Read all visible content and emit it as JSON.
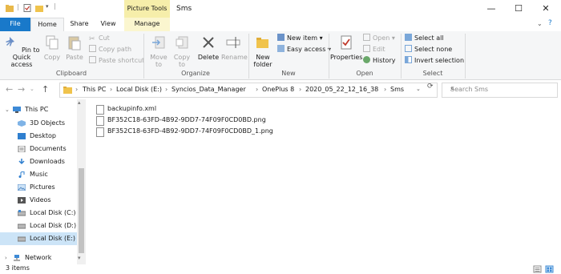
{
  "window": {
    "title": "Sms",
    "context_tab_group": "Picture Tools",
    "controls": {
      "minimize": "—",
      "maximize": "☐",
      "close": "✕"
    }
  },
  "tabs": [
    {
      "label": "File"
    },
    {
      "label": "Home"
    },
    {
      "label": "Share"
    },
    {
      "label": "View"
    },
    {
      "label": "Manage"
    }
  ],
  "ribbon": {
    "clipboard": {
      "label": "Clipboard",
      "pin_to_quick_access": "Pin to Quick access",
      "copy": "Copy",
      "paste": "Paste",
      "cut": "Cut",
      "copy_path": "Copy path",
      "paste_shortcut": "Paste shortcut"
    },
    "organize": {
      "label": "Organize",
      "move_to": "Move to",
      "copy_to": "Copy to",
      "delete": "Delete",
      "rename": "Rename"
    },
    "new": {
      "label": "New",
      "new_folder": "New folder",
      "new_item": "New item ▾",
      "easy_access": "Easy access ▾"
    },
    "open": {
      "label": "Open",
      "properties": "Properties",
      "open": "Open ▾",
      "edit": "Edit",
      "history": "History"
    },
    "select": {
      "label": "Select",
      "select_all": "Select all",
      "select_none": "Select none",
      "invert_selection": "Invert selection"
    }
  },
  "address": {
    "crumbs": [
      "This PC",
      "Local Disk (E:)",
      "Syncios_Data_Manager",
      "OnePlus 8",
      "2020_05_22_12_16_38",
      "Sms"
    ],
    "search_placeholder": "Search Sms"
  },
  "nav_pane": {
    "items": [
      {
        "label": "This PC",
        "icon": "pc-icon",
        "expanded": true
      },
      {
        "label": "3D Objects",
        "icon": "3d-objects-icon"
      },
      {
        "label": "Desktop",
        "icon": "desktop-icon"
      },
      {
        "label": "Documents",
        "icon": "documents-icon"
      },
      {
        "label": "Downloads",
        "icon": "downloads-icon"
      },
      {
        "label": "Music",
        "icon": "music-icon"
      },
      {
        "label": "Pictures",
        "icon": "pictures-icon"
      },
      {
        "label": "Videos",
        "icon": "videos-icon"
      },
      {
        "label": "Local Disk (C:)",
        "icon": "drive-icon"
      },
      {
        "label": "Local Disk (D:)",
        "icon": "drive-icon"
      },
      {
        "label": "Local Disk (E:)",
        "icon": "drive-icon",
        "selected": true
      },
      {
        "label": "Network",
        "icon": "network-icon"
      }
    ]
  },
  "files": [
    {
      "name": "backupinfo.xml"
    },
    {
      "name": "BF352C18-63FD-4B92-9DD7-74F09F0CD0BD.png"
    },
    {
      "name": "BF352C18-63FD-4B92-9DD7-74F09F0CD0BD_1.png"
    }
  ],
  "status": {
    "item_count": "3 items"
  },
  "colors": {
    "accent": "#1979ca",
    "picture_tools": "#f6eeaa",
    "selection": "#cce4f7"
  }
}
